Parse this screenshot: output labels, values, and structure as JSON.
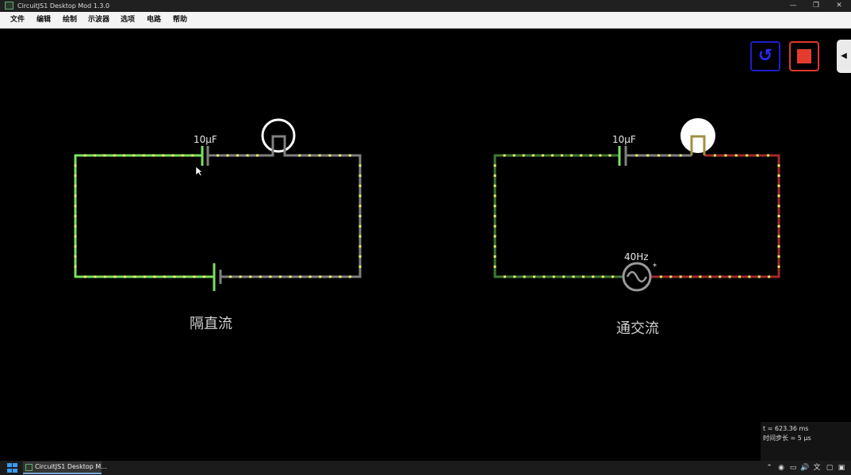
{
  "window": {
    "title": "CircuitJS1 Desktop Mod 1.3.0",
    "minimize": "—",
    "maximize": "❐",
    "close": "✕"
  },
  "menu": [
    "文件",
    "编辑",
    "绘制",
    "示波器",
    "选项",
    "电路",
    "帮助"
  ],
  "controls": {
    "reset_glyph": "↺",
    "panel_toggle_glyph": "◀"
  },
  "circuits": [
    {
      "capacitor_label": "10μF",
      "caption": "隔直流"
    },
    {
      "capacitor_label": "10μF",
      "source_label": "40Hz",
      "source_marker": "*",
      "caption": "通交流"
    }
  ],
  "info": {
    "time": "t = 623.36 ms",
    "timestep": "时间步长 = 5 μs"
  },
  "taskbar": {
    "app_label": "CircuitJS1 Desktop M..."
  },
  "colors": {
    "wire_active": "#7de060",
    "wire_dim": "#3f7a35",
    "wire_idle": "#808080",
    "wire_red": "#a22a2a",
    "dot": "#f2f26a"
  }
}
